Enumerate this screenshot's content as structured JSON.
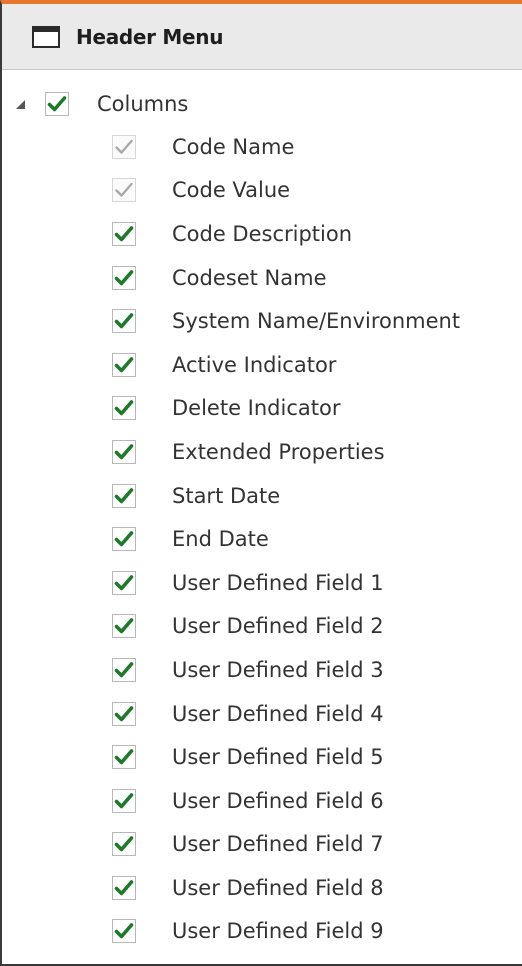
{
  "header": {
    "title": "Header Menu",
    "icon": "window-icon"
  },
  "tree": {
    "root": {
      "label": "Columns",
      "checked": true,
      "expanded": true
    },
    "children": [
      {
        "label": "Code Name",
        "checked": true,
        "disabled": true
      },
      {
        "label": "Code Value",
        "checked": true,
        "disabled": true
      },
      {
        "label": "Code Description",
        "checked": true,
        "disabled": false
      },
      {
        "label": "Codeset Name",
        "checked": true,
        "disabled": false
      },
      {
        "label": "System Name/Environment",
        "checked": true,
        "disabled": false
      },
      {
        "label": "Active Indicator",
        "checked": true,
        "disabled": false
      },
      {
        "label": "Delete Indicator",
        "checked": true,
        "disabled": false
      },
      {
        "label": "Extended Properties",
        "checked": true,
        "disabled": false
      },
      {
        "label": "Start Date",
        "checked": true,
        "disabled": false
      },
      {
        "label": "End Date",
        "checked": true,
        "disabled": false
      },
      {
        "label": "User Defined Field 1",
        "checked": true,
        "disabled": false
      },
      {
        "label": "User Defined Field 2",
        "checked": true,
        "disabled": false
      },
      {
        "label": "User Defined Field 3",
        "checked": true,
        "disabled": false
      },
      {
        "label": "User Defined Field 4",
        "checked": true,
        "disabled": false
      },
      {
        "label": "User Defined Field 5",
        "checked": true,
        "disabled": false
      },
      {
        "label": "User Defined Field 6",
        "checked": true,
        "disabled": false
      },
      {
        "label": "User Defined Field 7",
        "checked": true,
        "disabled": false
      },
      {
        "label": "User Defined Field 8",
        "checked": true,
        "disabled": false
      },
      {
        "label": "User Defined Field 9",
        "checked": true,
        "disabled": false
      }
    ]
  },
  "colors": {
    "accent_top": "#e8772e",
    "check_enabled": "#1c7a2a",
    "check_disabled": "#a9a9a9"
  }
}
